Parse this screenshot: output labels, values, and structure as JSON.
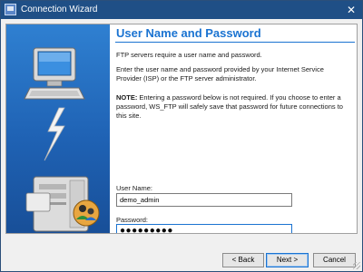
{
  "window": {
    "title": "Connection Wizard",
    "close_glyph": "✕"
  },
  "page": {
    "heading": "User Name and Password",
    "para1": "FTP servers require a user name and password.",
    "para2": "Enter the user name and password provided by your Internet Service Provider (ISP) or the FTP server administrator.",
    "note_label": "NOTE:",
    "note_text": " Entering a password below is not required. If you choose to enter a password, WS_FTP will safely save that password for future connections to this site."
  },
  "form": {
    "username_label": "User Name:",
    "username_value": "demo_admin",
    "password_label": "Password:",
    "password_value": "●●●●●●●●●"
  },
  "buttons": {
    "back": "< Back",
    "next": "Next >",
    "cancel": "Cancel"
  },
  "colors": {
    "titlebar": "#1f4f86",
    "accent": "#1a73d1",
    "side_panel": "#1f62b4"
  },
  "icons": {
    "app": "wizard-app-icon",
    "close": "close-icon",
    "computer": "computer-icon",
    "lightning": "lightning-bolt-icon",
    "server": "server-tower-icon",
    "users": "users-icon"
  }
}
